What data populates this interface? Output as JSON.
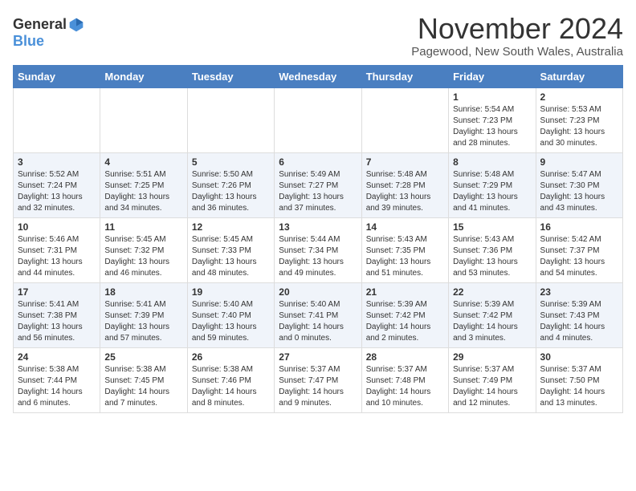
{
  "logo": {
    "general": "General",
    "blue": "Blue"
  },
  "header": {
    "month": "November 2024",
    "location": "Pagewood, New South Wales, Australia"
  },
  "weekdays": [
    "Sunday",
    "Monday",
    "Tuesday",
    "Wednesday",
    "Thursday",
    "Friday",
    "Saturday"
  ],
  "weeks": [
    [
      {
        "day": "",
        "info": ""
      },
      {
        "day": "",
        "info": ""
      },
      {
        "day": "",
        "info": ""
      },
      {
        "day": "",
        "info": ""
      },
      {
        "day": "",
        "info": ""
      },
      {
        "day": "1",
        "info": "Sunrise: 5:54 AM\nSunset: 7:23 PM\nDaylight: 13 hours and 28 minutes."
      },
      {
        "day": "2",
        "info": "Sunrise: 5:53 AM\nSunset: 7:23 PM\nDaylight: 13 hours and 30 minutes."
      }
    ],
    [
      {
        "day": "3",
        "info": "Sunrise: 5:52 AM\nSunset: 7:24 PM\nDaylight: 13 hours and 32 minutes."
      },
      {
        "day": "4",
        "info": "Sunrise: 5:51 AM\nSunset: 7:25 PM\nDaylight: 13 hours and 34 minutes."
      },
      {
        "day": "5",
        "info": "Sunrise: 5:50 AM\nSunset: 7:26 PM\nDaylight: 13 hours and 36 minutes."
      },
      {
        "day": "6",
        "info": "Sunrise: 5:49 AM\nSunset: 7:27 PM\nDaylight: 13 hours and 37 minutes."
      },
      {
        "day": "7",
        "info": "Sunrise: 5:48 AM\nSunset: 7:28 PM\nDaylight: 13 hours and 39 minutes."
      },
      {
        "day": "8",
        "info": "Sunrise: 5:48 AM\nSunset: 7:29 PM\nDaylight: 13 hours and 41 minutes."
      },
      {
        "day": "9",
        "info": "Sunrise: 5:47 AM\nSunset: 7:30 PM\nDaylight: 13 hours and 43 minutes."
      }
    ],
    [
      {
        "day": "10",
        "info": "Sunrise: 5:46 AM\nSunset: 7:31 PM\nDaylight: 13 hours and 44 minutes."
      },
      {
        "day": "11",
        "info": "Sunrise: 5:45 AM\nSunset: 7:32 PM\nDaylight: 13 hours and 46 minutes."
      },
      {
        "day": "12",
        "info": "Sunrise: 5:45 AM\nSunset: 7:33 PM\nDaylight: 13 hours and 48 minutes."
      },
      {
        "day": "13",
        "info": "Sunrise: 5:44 AM\nSunset: 7:34 PM\nDaylight: 13 hours and 49 minutes."
      },
      {
        "day": "14",
        "info": "Sunrise: 5:43 AM\nSunset: 7:35 PM\nDaylight: 13 hours and 51 minutes."
      },
      {
        "day": "15",
        "info": "Sunrise: 5:43 AM\nSunset: 7:36 PM\nDaylight: 13 hours and 53 minutes."
      },
      {
        "day": "16",
        "info": "Sunrise: 5:42 AM\nSunset: 7:37 PM\nDaylight: 13 hours and 54 minutes."
      }
    ],
    [
      {
        "day": "17",
        "info": "Sunrise: 5:41 AM\nSunset: 7:38 PM\nDaylight: 13 hours and 56 minutes."
      },
      {
        "day": "18",
        "info": "Sunrise: 5:41 AM\nSunset: 7:39 PM\nDaylight: 13 hours and 57 minutes."
      },
      {
        "day": "19",
        "info": "Sunrise: 5:40 AM\nSunset: 7:40 PM\nDaylight: 13 hours and 59 minutes."
      },
      {
        "day": "20",
        "info": "Sunrise: 5:40 AM\nSunset: 7:41 PM\nDaylight: 14 hours and 0 minutes."
      },
      {
        "day": "21",
        "info": "Sunrise: 5:39 AM\nSunset: 7:42 PM\nDaylight: 14 hours and 2 minutes."
      },
      {
        "day": "22",
        "info": "Sunrise: 5:39 AM\nSunset: 7:42 PM\nDaylight: 14 hours and 3 minutes."
      },
      {
        "day": "23",
        "info": "Sunrise: 5:39 AM\nSunset: 7:43 PM\nDaylight: 14 hours and 4 minutes."
      }
    ],
    [
      {
        "day": "24",
        "info": "Sunrise: 5:38 AM\nSunset: 7:44 PM\nDaylight: 14 hours and 6 minutes."
      },
      {
        "day": "25",
        "info": "Sunrise: 5:38 AM\nSunset: 7:45 PM\nDaylight: 14 hours and 7 minutes."
      },
      {
        "day": "26",
        "info": "Sunrise: 5:38 AM\nSunset: 7:46 PM\nDaylight: 14 hours and 8 minutes."
      },
      {
        "day": "27",
        "info": "Sunrise: 5:37 AM\nSunset: 7:47 PM\nDaylight: 14 hours and 9 minutes."
      },
      {
        "day": "28",
        "info": "Sunrise: 5:37 AM\nSunset: 7:48 PM\nDaylight: 14 hours and 10 minutes."
      },
      {
        "day": "29",
        "info": "Sunrise: 5:37 AM\nSunset: 7:49 PM\nDaylight: 14 hours and 12 minutes."
      },
      {
        "day": "30",
        "info": "Sunrise: 5:37 AM\nSunset: 7:50 PM\nDaylight: 14 hours and 13 minutes."
      }
    ]
  ]
}
